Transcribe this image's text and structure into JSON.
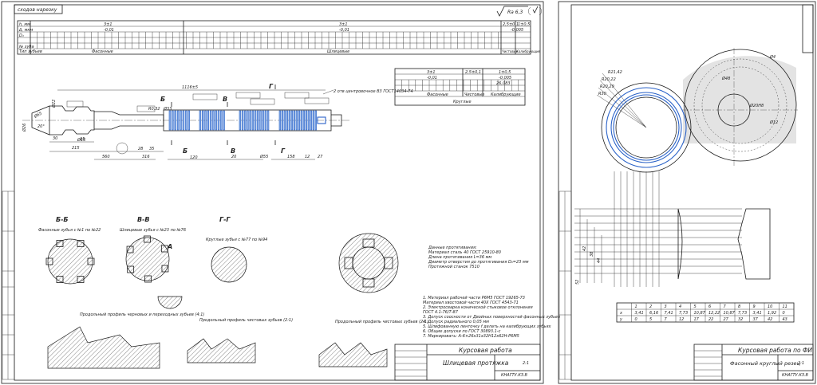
{
  "sheet1": {
    "corner_label": "сходов нарезку",
    "roughness": "Ra 6,3",
    "table_top": {
      "groups": [
        "3±1",
        "3±1",
        "2,5±0,1",
        "1±0,5"
      ],
      "row_labels": [
        "h, мм",
        "Δ, мкм",
        "D₁",
        "№ зуба",
        "Тип зубьев"
      ],
      "tol": [
        "-0,01",
        "-0,01",
        "-0,005"
      ],
      "types": [
        "Фасонные",
        "Шлицевые"
      ],
      "types_small": [
        "Чистовые",
        "Калибрующие"
      ]
    },
    "note_top": "2 отв центровочное В3 ГОСТ14034-74",
    "dims": [
      "1116±5",
      "Ø65",
      "20°",
      "Ø26",
      "Ø22",
      "30",
      "Ø16",
      "215",
      "25",
      "560",
      "28",
      "35",
      "316",
      "120",
      "20",
      "Ø55",
      "R0,32",
      "Ø33",
      "158",
      "12",
      "27"
    ],
    "section_letters": [
      "Б",
      "Б",
      "В",
      "В",
      "Г",
      "Г"
    ],
    "table_right": {
      "headers": [
        "3±1",
        "2,5±0,1",
        "1±0,5"
      ],
      "tol": [
        "-0,01",
        "-0,005"
      ],
      "types": [
        "Чистовые",
        "Калибрующие"
      ],
      "bottom": "Круглые",
      "tolerance2": "26,083"
    },
    "sections": [
      {
        "title": "Б-Б",
        "subtitle": "Фасонные зубья с №1 по №22"
      },
      {
        "title": "В-В",
        "subtitle": "Шлицевые зубья с №23 по №76"
      },
      {
        "title": "Г-Г",
        "subtitle": "Круглые зубья с №77 по №94"
      }
    ],
    "profiles": [
      {
        "title": "Продольный профиль черновых и переходных зубьев  (4:1)"
      },
      {
        "title": "Продольный профиль чистовых зубьев (2:1)"
      },
      {
        "title": "Продольный профиль чистовых зубьев (2:1)"
      }
    ],
    "requirements_head": [
      "Данные протягивания:",
      "Материал сталь 40 ГОСТ 25910-80",
      "Длина протягивания L=36 мм",
      "Диаметр отверстия до протягивания D₀=23 мм",
      "Протяжной станок 7510"
    ],
    "requirements": [
      "1. Материал рабочей части Р6М5 ГОСТ 19265-73",
      "Материал хвостовой части 40Х ГОСТ 4543-71",
      "2. Электросварка конической стыковое отклонения",
      "ГОСТ 4.1-76/Т-87",
      "3. Допуск соосности от Двойных поверхностей фасонных зубьев",
      "4. Допуск радиального 0,05 мм",
      "5. Шлифованную ленточку f делать на калибрующих зубьях",
      "6. Общие допуски по ГОСТ 30893.1-с",
      "7. Маркировать: А-6×26х31х32Н12х62Н-Р6М5"
    ],
    "title_block": {
      "title": "Курсовая работа",
      "name": "Шлицевая протяжка",
      "sheet": "2:1",
      "code": "КНАГТУ.КЗ.В"
    }
  },
  "sheet2": {
    "radii_labels": [
      "R21,42",
      "R20,22",
      "R20,29",
      "R30"
    ],
    "dims": [
      "Ø4",
      "Ø48",
      "Ø28",
      "Ø20Н8",
      "Ø12",
      "52",
      "42",
      "38",
      "44",
      "48"
    ],
    "note_center": "Ø48",
    "table": {
      "header": [
        "",
        "1",
        "2",
        "3",
        "4",
        "5",
        "6",
        "7",
        "8",
        "9",
        "10",
        "11"
      ],
      "x": [
        "x",
        "3,41",
        "6,16",
        "7,41",
        "7,73",
        "10,87",
        "12,22",
        "10,87",
        "7,73",
        "3,41",
        "1,92",
        "0"
      ],
      "y": [
        "y",
        "0",
        "5",
        "7",
        "12",
        "17",
        "22",
        "27",
        "32",
        "37",
        "42",
        "43"
      ]
    },
    "title_block": {
      "title": "Курсовая работа по ФИ",
      "name": "Фасонный круглый резец",
      "sheet": "2:1",
      "code": "КНАГТУ.КЗ.В"
    }
  },
  "colors": {
    "ink": "#1a1a1a",
    "blue": "#2a62c8",
    "bluefill": "#8fb2e8"
  }
}
